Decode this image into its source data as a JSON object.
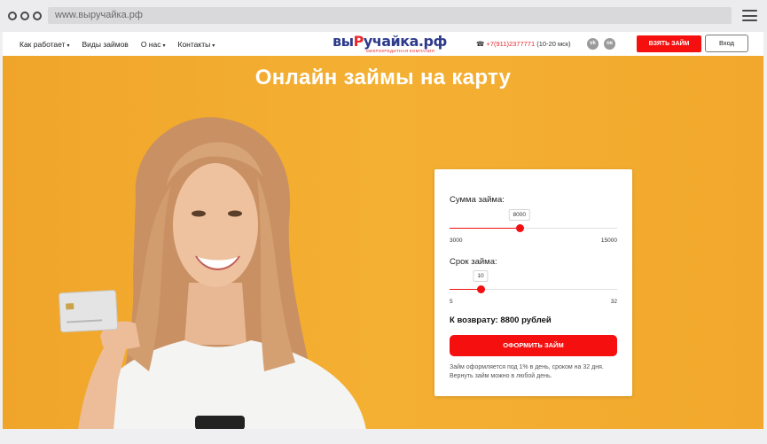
{
  "browser": {
    "url": "www.выручайка.рф"
  },
  "nav": {
    "items": [
      {
        "label": "Как работает",
        "caret": "▾"
      },
      {
        "label": "Виды займов",
        "caret": ""
      },
      {
        "label": "О нас",
        "caret": "▾"
      },
      {
        "label": "Контакты",
        "caret": "▾"
      }
    ],
    "logo": {
      "part1": "вы",
      "part2": "Р",
      "part3": "учайка.рф",
      "subtitle": "микрокредитная компания"
    },
    "phone": {
      "icon": "☎",
      "number": "+7(911)2377771",
      "hours": "(10-20 мск)"
    },
    "social": [
      {
        "icon": "vk-icon",
        "label": "vk"
      },
      {
        "icon": "ok-icon",
        "label": "ок"
      }
    ],
    "take_loan_label": "ВЗЯТЬ ЗАЙМ",
    "login_label": "Вход"
  },
  "hero": {
    "title": "Онлайн займы на карту"
  },
  "calculator": {
    "amount": {
      "label": "Сумма займа:",
      "value": 8000,
      "min": 3000,
      "max": 15000,
      "value_text": "8000",
      "min_text": "3000",
      "max_text": "15000"
    },
    "term": {
      "label": "Срок займа:",
      "value": 10,
      "min": 5,
      "max": 32,
      "value_text": "10",
      "min_text": "5",
      "max_text": "32"
    },
    "refund_text": "К возврату: 8800 рублей",
    "apply_label": "ОФОРМИТЬ ЗАЙМ",
    "note": "Займ оформляется под 1% в день, сроком на 32 дня. Вернуть займ можно в любой день."
  },
  "colors": {
    "accent": "#f50f0f",
    "hero_background": "#f3ab2b",
    "logo_blue": "#2d3a8c"
  }
}
